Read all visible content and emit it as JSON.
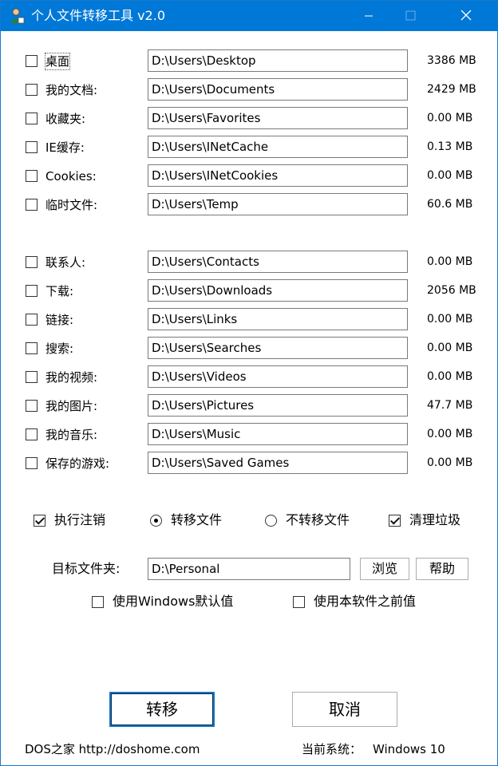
{
  "window": {
    "title": "个人文件转移工具 v2.0"
  },
  "folders": [
    {
      "label": "桌面",
      "path": "D:\\Users\\Desktop",
      "size": "3386 MB",
      "checked": false
    },
    {
      "label": "我的文档:",
      "path": "D:\\Users\\Documents",
      "size": "2429 MB",
      "checked": false
    },
    {
      "label": "收藏夹:",
      "path": "D:\\Users\\Favorites",
      "size": "0.00 MB",
      "checked": false
    },
    {
      "label": "IE缓存:",
      "path": "D:\\Users\\INetCache",
      "size": "0.13 MB",
      "checked": false
    },
    {
      "label": "Cookies:",
      "path": "D:\\Users\\INetCookies",
      "size": "0.00 MB",
      "checked": false
    },
    {
      "label": "临时文件:",
      "path": "D:\\Users\\Temp",
      "size": "60.6 MB",
      "checked": false
    },
    {
      "label": "联系人:",
      "path": "D:\\Users\\Contacts",
      "size": "0.00 MB",
      "checked": false
    },
    {
      "label": "下载:",
      "path": "D:\\Users\\Downloads",
      "size": "2056 MB",
      "checked": false
    },
    {
      "label": "链接:",
      "path": "D:\\Users\\Links",
      "size": "0.00 MB",
      "checked": false
    },
    {
      "label": "搜索:",
      "path": "D:\\Users\\Searches",
      "size": "0.00 MB",
      "checked": false
    },
    {
      "label": "我的视频:",
      "path": "D:\\Users\\Videos",
      "size": "0.00 MB",
      "checked": false
    },
    {
      "label": "我的图片:",
      "path": "D:\\Users\\Pictures",
      "size": "47.7 MB",
      "checked": false
    },
    {
      "label": "我的音乐:",
      "path": "D:\\Users\\Music",
      "size": "0.00 MB",
      "checked": false
    },
    {
      "label": "保存的游戏:",
      "path": "D:\\Users\\Saved Games",
      "size": "0.00 MB",
      "checked": false
    }
  ],
  "options": {
    "logoff": {
      "label": "执行注销",
      "checked": true
    },
    "move_files": {
      "label": "转移文件",
      "selected": true
    },
    "no_move_files": {
      "label": "不转移文件",
      "selected": false
    },
    "cleanup": {
      "label": "清理垃圾",
      "checked": true
    }
  },
  "target": {
    "label": "目标文件夹:",
    "value": "D:\\Personal",
    "browse_label": "浏览",
    "help_label": "帮助"
  },
  "defaults": {
    "windows_default": {
      "label": "使用Windows默认值",
      "checked": false
    },
    "previous_value": {
      "label": "使用本软件之前值",
      "checked": false
    }
  },
  "actions": {
    "transfer_label": "转移",
    "cancel_label": "取消"
  },
  "footer": {
    "brand": "DOS之家 http://doshome.com",
    "system_label": "当前系统：",
    "system_value": "Windows 10"
  },
  "colors": {
    "titlebar": "#0078d7",
    "background": "#ffffff",
    "accent": "#0078d7"
  }
}
